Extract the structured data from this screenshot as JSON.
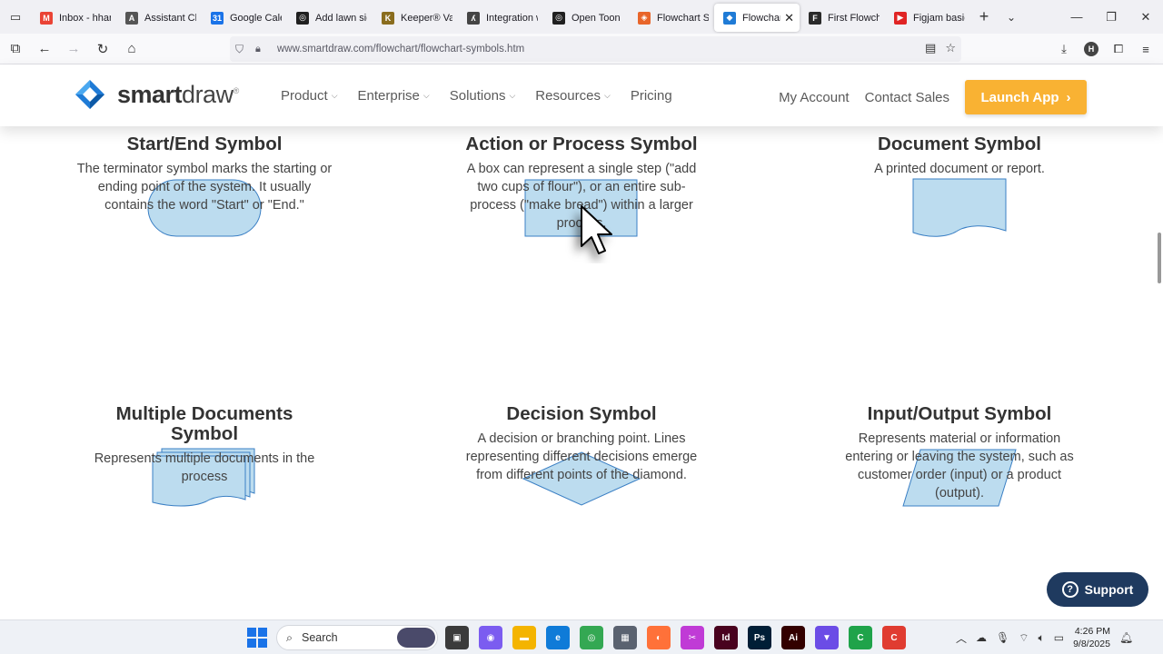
{
  "browser": {
    "tabs": [
      {
        "title": "Inbox - hhan",
        "fav_color": "#ea4335",
        "fav_glyph": "M"
      },
      {
        "title": "Assistant Cha",
        "fav_color": "#555555",
        "fav_glyph": "A"
      },
      {
        "title": "Google Caler",
        "fav_color": "#1a73e8",
        "fav_glyph": "31"
      },
      {
        "title": "Add lawn sig",
        "fav_color": "#202020",
        "fav_glyph": "◎"
      },
      {
        "title": "Keeper® Vau",
        "fav_color": "#8a6d1e",
        "fav_glyph": "K"
      },
      {
        "title": "Integration w",
        "fav_color": "#444444",
        "fav_glyph": "ʎ"
      },
      {
        "title": "Open Toon B",
        "fav_color": "#202020",
        "fav_glyph": "◎"
      },
      {
        "title": "Flowchart Sy",
        "fav_color": "#e8652a",
        "fav_glyph": "◈"
      },
      {
        "title": "Flowchart",
        "fav_color": "#1f7bd6",
        "fav_glyph": "◆",
        "active": true
      },
      {
        "title": "First Flowcha",
        "fav_color": "#2a2a2a",
        "fav_glyph": "F"
      },
      {
        "title": "Figjam basic",
        "fav_color": "#e02424",
        "fav_glyph": "▶"
      }
    ],
    "url": "www.smartdraw.com/flowchart/flowchart-symbols.htm",
    "profile_initial": "H"
  },
  "site": {
    "logo_bold": "smart",
    "logo_light": "draw",
    "logo_mark": "®",
    "menu": [
      {
        "label": "Product",
        "has_dropdown": true
      },
      {
        "label": "Enterprise",
        "has_dropdown": true
      },
      {
        "label": "Solutions",
        "has_dropdown": true
      },
      {
        "label": "Resources",
        "has_dropdown": true
      },
      {
        "label": "Pricing",
        "has_dropdown": false
      }
    ],
    "my_account": "My Account",
    "contact_sales": "Contact Sales",
    "launch_app": "Launch App",
    "brand_color": "#f9b233"
  },
  "symbols": [
    {
      "shape": "terminator",
      "title": "Start/End Symbol",
      "desc": "The terminator symbol marks the starting or ending point of the system. It usually contains the word \"Start\" or \"End.\""
    },
    {
      "shape": "process",
      "title": "Action or Process Symbol",
      "desc": "A box can represent a single step (\"add two cups of flour\"), or an entire sub-process (\"make bread\") within a larger process."
    },
    {
      "shape": "document",
      "title": "Document Symbol",
      "desc": "A printed document or report."
    },
    {
      "shape": "multi-document",
      "title": "Multiple Documents Symbol",
      "desc": "Represents multiple documents in the process"
    },
    {
      "shape": "decision",
      "title": "Decision Symbol",
      "desc": "A decision or branching point. Lines representing different decisions emerge from different points of the diamond."
    },
    {
      "shape": "io",
      "title": "Input/Output Symbol",
      "desc": "Represents material or information entering or leaving the system, such as customer order (input) or a product (output)."
    }
  ],
  "shape_fill": "#bcdcef",
  "shape_stroke": "#3a7fc4",
  "support_label": "Support",
  "taskbar": {
    "search_placeholder": "Search",
    "time": "4:26 PM",
    "date": "9/8/2025",
    "apps": [
      {
        "name": "task-view",
        "color": "#3b3b3b",
        "glyph": "▣"
      },
      {
        "name": "copilot",
        "color": "#7b5cf0",
        "glyph": "◉"
      },
      {
        "name": "file-explorer",
        "color": "#f4b400",
        "glyph": "▬"
      },
      {
        "name": "edge",
        "color": "#0f7bd8",
        "glyph": "e"
      },
      {
        "name": "chrome",
        "color": "#34a853",
        "glyph": "◎"
      },
      {
        "name": "calculator",
        "color": "#5a6270",
        "glyph": "▦"
      },
      {
        "name": "firefox",
        "color": "#ff7139",
        "glyph": "◐"
      },
      {
        "name": "snipping-tool",
        "color": "#c03bd6",
        "glyph": "✂"
      },
      {
        "name": "indesign",
        "color": "#49021f",
        "glyph": "Id"
      },
      {
        "name": "photoshop",
        "color": "#001e36",
        "glyph": "Ps"
      },
      {
        "name": "illustrator",
        "color": "#330000",
        "glyph": "Ai"
      },
      {
        "name": "vpn",
        "color": "#6b4ce6",
        "glyph": "▼"
      },
      {
        "name": "camtasia",
        "color": "#1fa34a",
        "glyph": "C"
      },
      {
        "name": "recorder",
        "color": "#e03c31",
        "glyph": "C"
      }
    ]
  }
}
